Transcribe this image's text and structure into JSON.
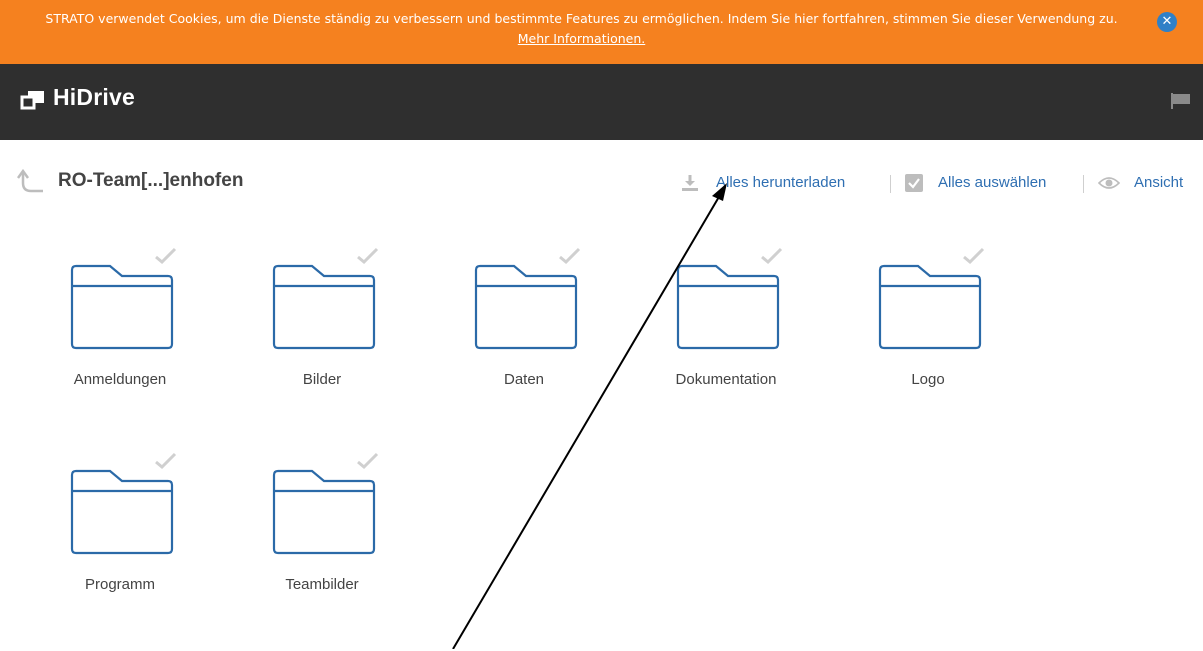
{
  "cookie": {
    "text": "STRATO verwendet Cookies, um die Dienste ständig zu verbessern und bestimmte Features zu ermöglichen. Indem Sie hier fortfahren, stimmen Sie dieser Verwendung zu.",
    "link": "Mehr Informationen.",
    "close_icon": "close-icon"
  },
  "header": {
    "app_name": "HiDrive",
    "logo_icon": "hidrive-logo-icon",
    "flag_icon": "flag-icon"
  },
  "breadcrumb": {
    "folder": "RO-Team[...]enhofen",
    "up_icon": "up-arrow-icon"
  },
  "actions": {
    "download_all": "Alles herunterladen",
    "select_all": "Alles auswählen",
    "view": "Ansicht"
  },
  "folders": [
    {
      "name": "Anmeldungen"
    },
    {
      "name": "Bilder"
    },
    {
      "name": "Daten"
    },
    {
      "name": "Dokumentation"
    },
    {
      "name": "Logo"
    },
    {
      "name": "Programm"
    },
    {
      "name": "Teambilder"
    }
  ],
  "colors": {
    "banner": "#f5811f",
    "header": "#2f2f2f",
    "link": "#2f6fb2",
    "folder_stroke": "#2b6aa8"
  }
}
